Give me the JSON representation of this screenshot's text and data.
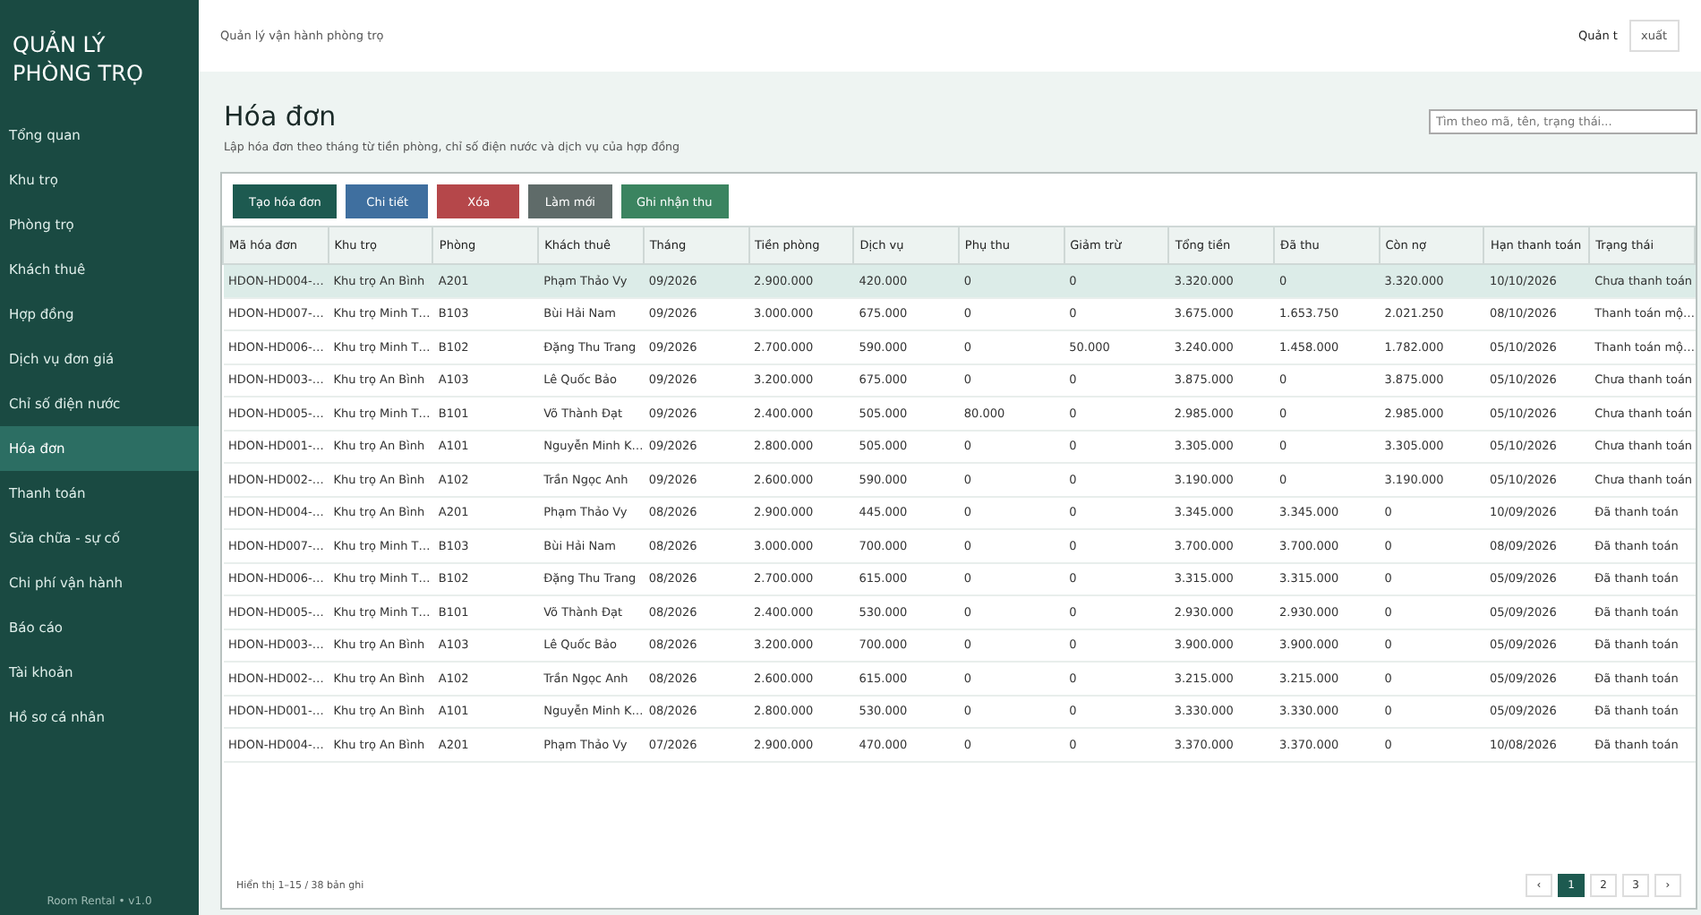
{
  "sidebar": {
    "title": "QUẢN LÝ PHÒNG TRỌ",
    "items": [
      {
        "label": "Tổng quan",
        "selected": false
      },
      {
        "label": "Khu trọ",
        "selected": false
      },
      {
        "label": "Phòng trọ",
        "selected": false
      },
      {
        "label": "Khách thuê",
        "selected": false
      },
      {
        "label": "Hợp đồng",
        "selected": false
      },
      {
        "label": "Dịch vụ  đơn giá",
        "selected": false
      },
      {
        "label": "Chỉ số điện nước",
        "selected": false
      },
      {
        "label": "Hóa đơn",
        "selected": true
      },
      {
        "label": "Thanh toán",
        "selected": false
      },
      {
        "label": "Sửa chữa - sự cố",
        "selected": false
      },
      {
        "label": "Chi phí vận hành",
        "selected": false
      },
      {
        "label": "Báo cáo",
        "selected": false
      },
      {
        "label": "Tài khoản",
        "selected": false
      },
      {
        "label": "Hồ sơ cá nhân",
        "selected": false
      }
    ],
    "footer": "Room Rental • v1.0"
  },
  "header": {
    "breadcrumb": "Quản lý vận hành phòng trọ",
    "user": "Quản t",
    "logout_button": "xuất"
  },
  "page": {
    "title": "Hóa đơn",
    "subtitle": "Lập hóa đơn theo tháng từ tiền phòng, chỉ số điện nước và dịch vụ của hợp đồng",
    "search": {
      "placeholder": "Tìm theo mã, tên, trạng thái..."
    }
  },
  "toolbar": [
    {
      "label": "Tạo hóa đơn",
      "kind": "create"
    },
    {
      "label": "Chi tiết",
      "kind": "detail"
    },
    {
      "label": "Xóa",
      "kind": "delete"
    },
    {
      "label": "Làm mới",
      "kind": "refresh"
    },
    {
      "label": "Ghi nhận thu",
      "kind": "collect"
    }
  ],
  "table": {
    "columns": [
      "Mã hóa đơn",
      "Khu trọ",
      "Phòng",
      "Khách thuê",
      "Tháng",
      "Tiền phòng",
      "Dịch vụ",
      "Phụ thu",
      "Giảm trừ",
      "Tổng tiền",
      "Đã thu",
      "Còn nợ",
      "Hạn thanh toán",
      "Trạng thái"
    ],
    "rows": [
      {
        "selected": true,
        "cells": [
          "HDON-HD004-…",
          "Khu trọ An Bình",
          "A201",
          "Phạm Thảo Vy",
          "09/2026",
          "2.900.000",
          "420.000",
          "0",
          "0",
          "3.320.000",
          "0",
          "3.320.000",
          "10/10/2026",
          "Chưa thanh toán"
        ]
      },
      {
        "selected": false,
        "cells": [
          "HDON-HD007-…",
          "Khu trọ Minh T…",
          "B103",
          "Bùi Hải Nam",
          "09/2026",
          "3.000.000",
          "675.000",
          "0",
          "0",
          "3.675.000",
          "1.653.750",
          "2.021.250",
          "08/10/2026",
          "Thanh toán mộ…"
        ]
      },
      {
        "selected": false,
        "cells": [
          "HDON-HD006-…",
          "Khu trọ Minh T…",
          "B102",
          "Đặng Thu Trang",
          "09/2026",
          "2.700.000",
          "590.000",
          "0",
          "50.000",
          "3.240.000",
          "1.458.000",
          "1.782.000",
          "05/10/2026",
          "Thanh toán mộ…"
        ]
      },
      {
        "selected": false,
        "cells": [
          "HDON-HD003-…",
          "Khu trọ An Bình",
          "A103",
          "Lê Quốc Bảo",
          "09/2026",
          "3.200.000",
          "675.000",
          "0",
          "0",
          "3.875.000",
          "0",
          "3.875.000",
          "05/10/2026",
          "Chưa thanh toán"
        ]
      },
      {
        "selected": false,
        "cells": [
          "HDON-HD005-…",
          "Khu trọ Minh T…",
          "B101",
          "Võ Thành Đạt",
          "09/2026",
          "2.400.000",
          "505.000",
          "80.000",
          "0",
          "2.985.000",
          "0",
          "2.985.000",
          "05/10/2026",
          "Chưa thanh toán"
        ]
      },
      {
        "selected": false,
        "cells": [
          "HDON-HD001-…",
          "Khu trọ An Bình",
          "A101",
          "Nguyễn Minh K…",
          "09/2026",
          "2.800.000",
          "505.000",
          "0",
          "0",
          "3.305.000",
          "0",
          "3.305.000",
          "05/10/2026",
          "Chưa thanh toán"
        ]
      },
      {
        "selected": false,
        "cells": [
          "HDON-HD002-…",
          "Khu trọ An Bình",
          "A102",
          "Trần Ngọc Anh",
          "09/2026",
          "2.600.000",
          "590.000",
          "0",
          "0",
          "3.190.000",
          "0",
          "3.190.000",
          "05/10/2026",
          "Chưa thanh toán"
        ]
      },
      {
        "selected": false,
        "cells": [
          "HDON-HD004-…",
          "Khu trọ An Bình",
          "A201",
          "Phạm Thảo Vy",
          "08/2026",
          "2.900.000",
          "445.000",
          "0",
          "0",
          "3.345.000",
          "3.345.000",
          "0",
          "10/09/2026",
          "Đã thanh toán"
        ]
      },
      {
        "selected": false,
        "cells": [
          "HDON-HD007-…",
          "Khu trọ Minh T…",
          "B103",
          "Bùi Hải Nam",
          "08/2026",
          "3.000.000",
          "700.000",
          "0",
          "0",
          "3.700.000",
          "3.700.000",
          "0",
          "08/09/2026",
          "Đã thanh toán"
        ]
      },
      {
        "selected": false,
        "cells": [
          "HDON-HD006-…",
          "Khu trọ Minh T…",
          "B102",
          "Đặng Thu Trang",
          "08/2026",
          "2.700.000",
          "615.000",
          "0",
          "0",
          "3.315.000",
          "3.315.000",
          "0",
          "05/09/2026",
          "Đã thanh toán"
        ]
      },
      {
        "selected": false,
        "cells": [
          "HDON-HD005-…",
          "Khu trọ Minh T…",
          "B101",
          "Võ Thành Đạt",
          "08/2026",
          "2.400.000",
          "530.000",
          "0",
          "0",
          "2.930.000",
          "2.930.000",
          "0",
          "05/09/2026",
          "Đã thanh toán"
        ]
      },
      {
        "selected": false,
        "cells": [
          "HDON-HD003-…",
          "Khu trọ An Bình",
          "A103",
          "Lê Quốc Bảo",
          "08/2026",
          "3.200.000",
          "700.000",
          "0",
          "0",
          "3.900.000",
          "3.900.000",
          "0",
          "05/09/2026",
          "Đã thanh toán"
        ]
      },
      {
        "selected": false,
        "cells": [
          "HDON-HD002-…",
          "Khu trọ An Bình",
          "A102",
          "Trần Ngọc Anh",
          "08/2026",
          "2.600.000",
          "615.000",
          "0",
          "0",
          "3.215.000",
          "3.215.000",
          "0",
          "05/09/2026",
          "Đã thanh toán"
        ]
      },
      {
        "selected": false,
        "cells": [
          "HDON-HD001-…",
          "Khu trọ An Bình",
          "A101",
          "Nguyễn Minh K…",
          "08/2026",
          "2.800.000",
          "530.000",
          "0",
          "0",
          "3.330.000",
          "3.330.000",
          "0",
          "05/09/2026",
          "Đã thanh toán"
        ]
      },
      {
        "selected": false,
        "cells": [
          "HDON-HD004-…",
          "Khu trọ An Bình",
          "A201",
          "Phạm Thảo Vy",
          "07/2026",
          "2.900.000",
          "470.000",
          "0",
          "0",
          "3.370.000",
          "3.370.000",
          "0",
          "10/08/2026",
          "Đã thanh toán"
        ]
      }
    ]
  },
  "footer": {
    "summary": "Hiển thị 1–15 / 38 bản ghi",
    "pagination": [
      {
        "label": "‹",
        "selected": false
      },
      {
        "label": "1",
        "selected": true
      },
      {
        "label": "2",
        "selected": false
      },
      {
        "label": "3",
        "selected": false
      },
      {
        "label": "›",
        "selected": false
      }
    ]
  }
}
